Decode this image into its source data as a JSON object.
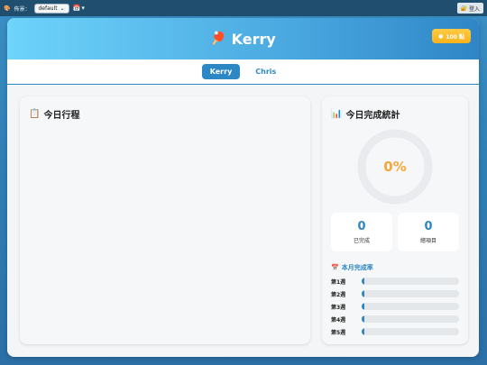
{
  "topbar": {
    "theme_label": "佈景：",
    "theme_value": "default",
    "calendar_icon": "calendar-icon",
    "login_label": "登入"
  },
  "header": {
    "title": "Kerry",
    "points_label": "100 點"
  },
  "tabs": [
    {
      "label": "Kerry",
      "active": true
    },
    {
      "label": "Chris",
      "active": false
    }
  ],
  "schedule_panel": {
    "title": "今日行程"
  },
  "stats_panel": {
    "title": "今日完成統計",
    "percent_text": "0%",
    "percent_value": 0,
    "completed_count": "0",
    "completed_label": "已完成",
    "total_count": "0",
    "total_label": "總項目",
    "monthly_title": "本月完成率",
    "weeks": [
      {
        "label": "第1週",
        "rate": 0
      },
      {
        "label": "第2週",
        "rate": 0
      },
      {
        "label": "第3週",
        "rate": 0
      },
      {
        "label": "第4週",
        "rate": 0
      },
      {
        "label": "第5週",
        "rate": 0
      }
    ]
  },
  "colors": {
    "accent": "#2c87c4",
    "percent": "#f2a83a"
  }
}
